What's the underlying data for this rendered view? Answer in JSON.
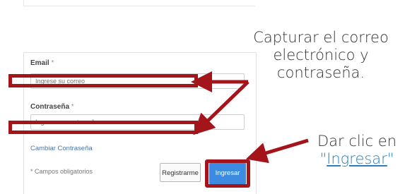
{
  "form": {
    "email_label": "Email",
    "email_required_mark": "*",
    "email_placeholder": "Ingrese su correo",
    "password_label": "Contraseña",
    "password_required_mark": "*",
    "password_placeholder": "Ingrese su contraseña",
    "change_password_link": "Cambiar Contraseña",
    "required_note": "* Campos obligatorios",
    "register_button": "Registrarme",
    "login_button": "Ingresar"
  },
  "annotations": {
    "capture_text": "Capturar el correo electrónico y contraseña.",
    "click_prefix": "Dar clic en",
    "click_open_quote": "\"",
    "click_link": "Ingresar",
    "click_close_quote": "\""
  },
  "colors": {
    "highlight": "#a3151b",
    "button_primary": "#3c8be0",
    "link": "#4a76a8"
  }
}
